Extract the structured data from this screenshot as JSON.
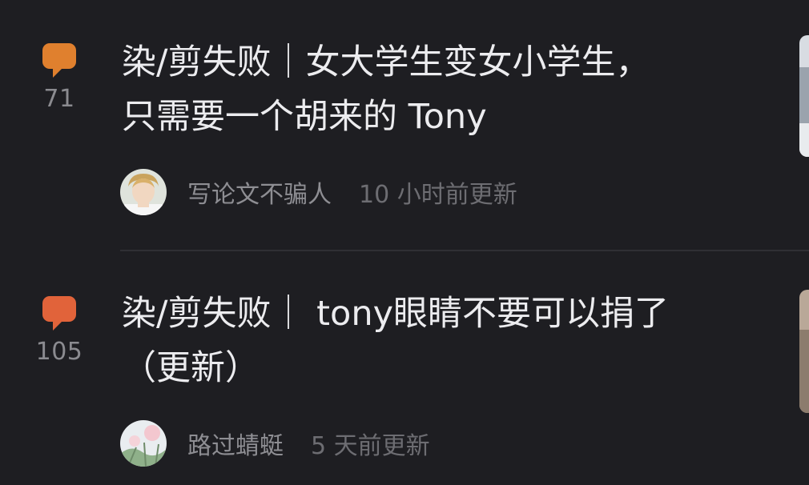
{
  "colors": {
    "background": "#1e1e22",
    "bubble_orange": "#e0802e",
    "bubble_orange_red": "#e1633a"
  },
  "posts": [
    {
      "comment_icon": "comment-bubble-icon",
      "comment_count": "71",
      "title_line1": "染/剪失败｜女大学生变女小学生，",
      "title_line2": "只需要一个胡来的 Tony",
      "author": "写论文不骗人",
      "time": "10 小时前更新"
    },
    {
      "comment_icon": "comment-bubble-icon",
      "comment_count": "105",
      "title_line1": "染/剪失败｜ tony眼睛不要可以捐了",
      "title_line2": "（更新）",
      "author": "路过蜻蜓",
      "time": "5 天前更新"
    }
  ]
}
